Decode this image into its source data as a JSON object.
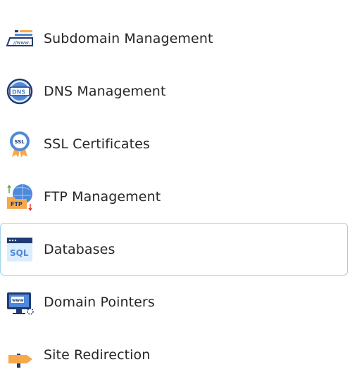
{
  "menu": {
    "items": [
      {
        "label": "Subdomain Management",
        "icon": "subdomain-www-icon"
      },
      {
        "label": "DNS Management",
        "icon": "dns-globe-icon"
      },
      {
        "label": "SSL Certificates",
        "icon": "ssl-badge-icon"
      },
      {
        "label": "FTP Management",
        "icon": "ftp-folder-globe-icon"
      },
      {
        "label": "Databases",
        "icon": "sql-window-icon",
        "active": true
      },
      {
        "label": "Domain Pointers",
        "icon": "monitor-www-icon"
      },
      {
        "label": "Site Redirection",
        "icon": "redirect-arrow-icon"
      }
    ]
  },
  "colors": {
    "active_border": "#9ed3ea",
    "icon_blue": "#4f89d9",
    "icon_orange": "#f7a84a",
    "icon_navy": "#1f3b73"
  }
}
